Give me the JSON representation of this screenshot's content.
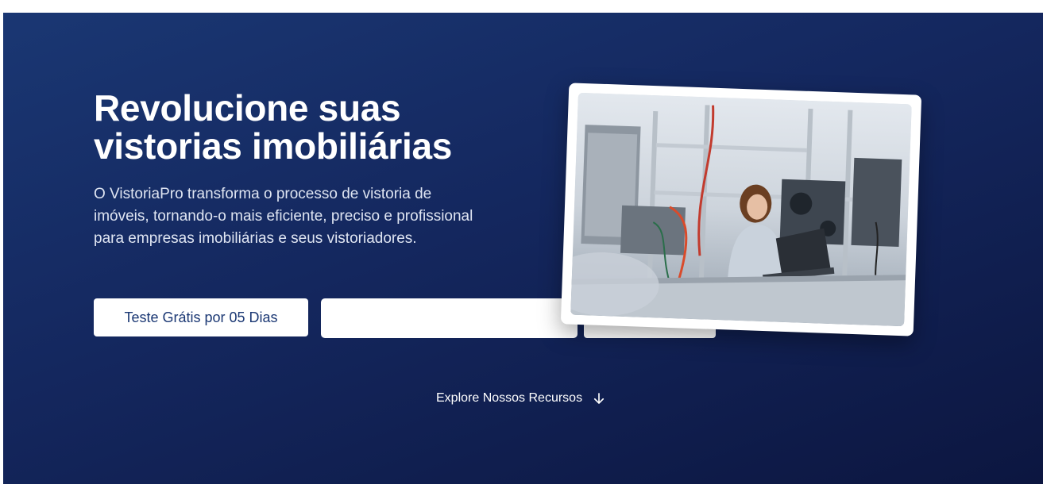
{
  "hero": {
    "headline": "Revolucione suas vistorias imobiliárias",
    "description": "O VistoriaPro transforma o processo de vistoria de imóveis, tornando-o mais eficiente, preciso e profissional para empresas imobiliárias e seus vistoriadores.",
    "primary_button": "Teste Grátis por 05 Dias",
    "secondary_button": "",
    "tertiary_button": "",
    "image_icon": "photo-lab-woman-laptop",
    "explore_link": "Explore Nossos Recursos",
    "explore_icon": "arrow-down-icon"
  },
  "colors": {
    "hero_bg_start": "#1a3773",
    "hero_bg_end": "#0c1640",
    "button_bg": "#ffffff",
    "button_text": "#1a3773",
    "text": "#ffffff"
  }
}
